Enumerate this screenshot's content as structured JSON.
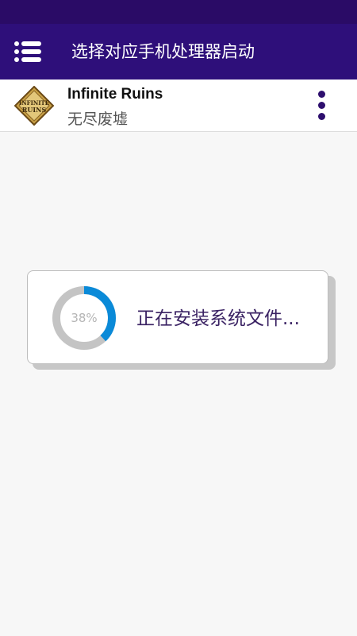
{
  "app_bar": {
    "title": "选择对应手机处理器启动",
    "menu_icon": "hamburger-menu-icon",
    "background": "#2e0f7a"
  },
  "game": {
    "title": "Infinite Ruins",
    "subtitle": "无尽废墟",
    "logo_text_line1": "INFINITE",
    "logo_text_line2": "RUINS",
    "overflow_icon": "more-vert-icon"
  },
  "dialog": {
    "progress_label": "38%",
    "progress_value": 38,
    "message": "正在安装系统文件...",
    "progress_color": "#0a8ad8",
    "track_color": "#c4c4c4"
  }
}
